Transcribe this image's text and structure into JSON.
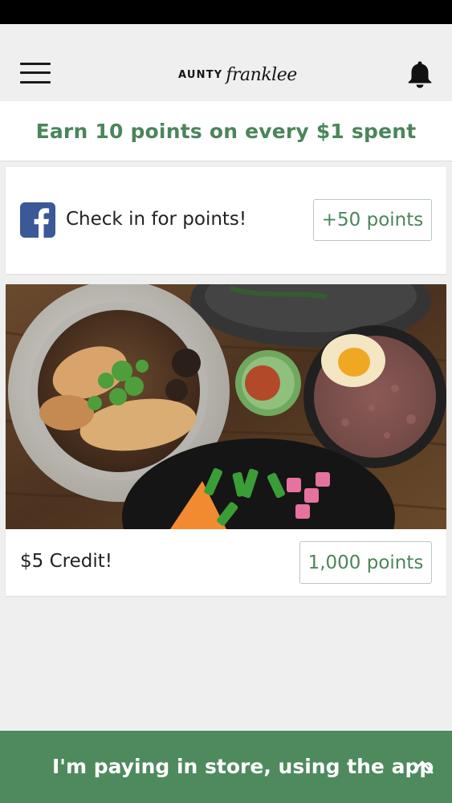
{
  "header": {
    "brand_word_1": "AUNTY",
    "brand_word_2": "franklee",
    "menu_icon": "hamburger-menu-icon",
    "notification_icon": "bell-icon"
  },
  "banner": {
    "earn_text": "Earn 10 points on every $1 spent"
  },
  "checkin_card": {
    "icon": "facebook-icon",
    "label": "Check in for points!",
    "points_label": "+50 points"
  },
  "reward_card": {
    "image": "food-bowls-photo",
    "label": "$5 Credit!",
    "points_label": "1,000 points"
  },
  "footer": {
    "pay_label": "I'm paying in store, using the app",
    "chevron_icon": "chevron-up-icon"
  },
  "colors": {
    "accent_green": "#4b855b",
    "footer_green": "#4e8a5d",
    "facebook_blue": "#3b5998",
    "background": "#efeff0"
  }
}
